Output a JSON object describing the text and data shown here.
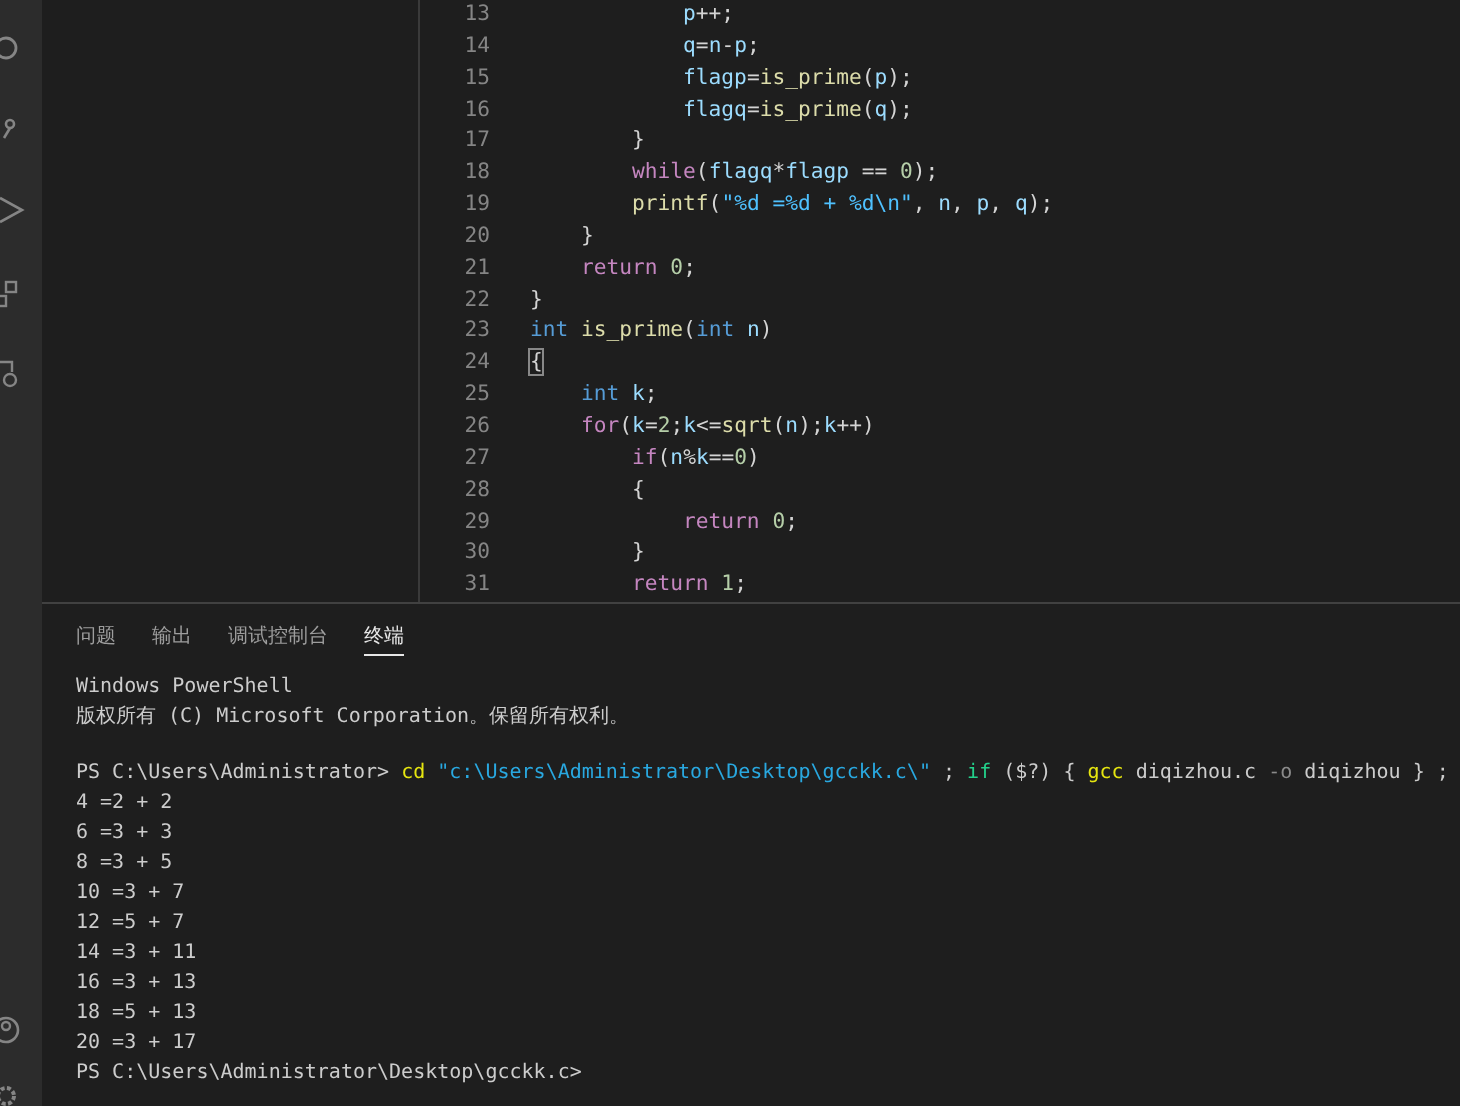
{
  "editor": {
    "lines": [
      {
        "number": "13",
        "tokens": [
          {
            "kind": "var",
            "text": "            p"
          },
          {
            "kind": "punct",
            "text": "++;"
          }
        ]
      },
      {
        "number": "14",
        "tokens": [
          {
            "kind": "var",
            "text": "            q"
          },
          {
            "kind": "punct",
            "text": "="
          },
          {
            "kind": "var",
            "text": "n"
          },
          {
            "kind": "punct",
            "text": "-"
          },
          {
            "kind": "var",
            "text": "p"
          },
          {
            "kind": "punct",
            "text": ";"
          }
        ]
      },
      {
        "number": "15",
        "tokens": [
          {
            "kind": "var",
            "text": "            flagp"
          },
          {
            "kind": "punct",
            "text": "="
          },
          {
            "kind": "fn",
            "text": "is_prime"
          },
          {
            "kind": "punct",
            "text": "("
          },
          {
            "kind": "var",
            "text": "p"
          },
          {
            "kind": "punct",
            "text": ");"
          }
        ]
      },
      {
        "number": "16",
        "tokens": [
          {
            "kind": "var",
            "text": "            flagq"
          },
          {
            "kind": "punct",
            "text": "="
          },
          {
            "kind": "fn",
            "text": "is_prime"
          },
          {
            "kind": "punct",
            "text": "("
          },
          {
            "kind": "var",
            "text": "q"
          },
          {
            "kind": "punct",
            "text": ");"
          }
        ]
      },
      {
        "number": "17",
        "tokens": [
          {
            "kind": "punct",
            "text": "        }"
          }
        ]
      },
      {
        "number": "18",
        "tokens": [
          {
            "kind": "kw",
            "text": "        while"
          },
          {
            "kind": "punct",
            "text": "("
          },
          {
            "kind": "var",
            "text": "flagq"
          },
          {
            "kind": "punct",
            "text": "*"
          },
          {
            "kind": "var",
            "text": "flagp"
          },
          {
            "kind": "punct",
            "text": " == "
          },
          {
            "kind": "num",
            "text": "0"
          },
          {
            "kind": "punct",
            "text": ");"
          }
        ]
      },
      {
        "number": "19",
        "tokens": [
          {
            "kind": "fn",
            "text": "        printf"
          },
          {
            "kind": "punct",
            "text": "("
          },
          {
            "kind": "str",
            "text": "\"%d =%d + %d\\n\""
          },
          {
            "kind": "punct",
            "text": ", "
          },
          {
            "kind": "var",
            "text": "n"
          },
          {
            "kind": "punct",
            "text": ", "
          },
          {
            "kind": "var",
            "text": "p"
          },
          {
            "kind": "punct",
            "text": ", "
          },
          {
            "kind": "var",
            "text": "q"
          },
          {
            "kind": "punct",
            "text": ");"
          }
        ]
      },
      {
        "number": "20",
        "tokens": [
          {
            "kind": "punct",
            "text": "    }"
          }
        ]
      },
      {
        "number": "21",
        "tokens": [
          {
            "kind": "kw",
            "text": "    return "
          },
          {
            "kind": "num",
            "text": "0"
          },
          {
            "kind": "punct",
            "text": ";"
          }
        ]
      },
      {
        "number": "22",
        "tokens": [
          {
            "kind": "punct",
            "text": "}"
          }
        ]
      },
      {
        "number": "23",
        "tokens": [
          {
            "kind": "type",
            "text": "int "
          },
          {
            "kind": "fn",
            "text": "is_prime"
          },
          {
            "kind": "punct",
            "text": "("
          },
          {
            "kind": "type",
            "text": "int"
          },
          {
            "kind": "var",
            "text": " n"
          },
          {
            "kind": "punct",
            "text": ")"
          }
        ]
      },
      {
        "number": "24",
        "tokens": [
          {
            "kind": "match",
            "text": "{"
          }
        ]
      },
      {
        "number": "25",
        "tokens": [
          {
            "kind": "type",
            "text": "    int"
          },
          {
            "kind": "var",
            "text": " k"
          },
          {
            "kind": "punct",
            "text": ";"
          }
        ]
      },
      {
        "number": "26",
        "tokens": [
          {
            "kind": "kw",
            "text": "    for"
          },
          {
            "kind": "punct",
            "text": "("
          },
          {
            "kind": "var",
            "text": "k"
          },
          {
            "kind": "punct",
            "text": "="
          },
          {
            "kind": "num",
            "text": "2"
          },
          {
            "kind": "punct",
            "text": ";"
          },
          {
            "kind": "var",
            "text": "k"
          },
          {
            "kind": "punct",
            "text": "<="
          },
          {
            "kind": "fn",
            "text": "sqrt"
          },
          {
            "kind": "punct",
            "text": "("
          },
          {
            "kind": "var",
            "text": "n"
          },
          {
            "kind": "punct",
            "text": ");"
          },
          {
            "kind": "var",
            "text": "k"
          },
          {
            "kind": "punct",
            "text": "++)"
          }
        ]
      },
      {
        "number": "27",
        "tokens": [
          {
            "kind": "kw",
            "text": "        if"
          },
          {
            "kind": "punct",
            "text": "("
          },
          {
            "kind": "var",
            "text": "n"
          },
          {
            "kind": "punct",
            "text": "%"
          },
          {
            "kind": "var",
            "text": "k"
          },
          {
            "kind": "punct",
            "text": "=="
          },
          {
            "kind": "num",
            "text": "0"
          },
          {
            "kind": "punct",
            "text": ")"
          }
        ]
      },
      {
        "number": "28",
        "tokens": [
          {
            "kind": "punct",
            "text": "        {"
          }
        ]
      },
      {
        "number": "29",
        "tokens": [
          {
            "kind": "kw",
            "text": "            return "
          },
          {
            "kind": "num",
            "text": "0"
          },
          {
            "kind": "punct",
            "text": ";"
          }
        ]
      },
      {
        "number": "30",
        "tokens": [
          {
            "kind": "punct",
            "text": "        }"
          }
        ]
      },
      {
        "number": "31",
        "tokens": [
          {
            "kind": "kw",
            "text": "        return "
          },
          {
            "kind": "num",
            "text": "1"
          },
          {
            "kind": "punct",
            "text": ";"
          }
        ]
      }
    ]
  },
  "panel": {
    "tabs": [
      {
        "label": "问题",
        "selected": false
      },
      {
        "label": "输出",
        "selected": false
      },
      {
        "label": "调试控制台",
        "selected": false
      },
      {
        "label": "终端",
        "selected": true
      }
    ],
    "terminal": {
      "blocks": [
        {
          "lines": [
            [
              {
                "kind": "plain",
                "text": "Windows PowerShell"
              }
            ],
            [
              {
                "kind": "plain",
                "text": "版权所有 (C) Microsoft Corporation。保留所有权利。"
              }
            ]
          ]
        },
        {
          "lines": [
            [
              {
                "kind": "plain",
                "text": "PS C:\\Users\\Administrator> "
              },
              {
                "kind": "cmd",
                "text": "cd"
              },
              {
                "kind": "str",
                "text": " \"c:\\Users\\Administrator\\Desktop\\gcckk.c\\\""
              },
              {
                "kind": "plain",
                "text": " ; "
              },
              {
                "kind": "kw",
                "text": "if"
              },
              {
                "kind": "plain",
                "text": " ($?) { "
              },
              {
                "kind": "cmd",
                "text": "gcc"
              },
              {
                "kind": "plain",
                "text": " diqizhou.c "
              },
              {
                "kind": "flag",
                "text": "-o"
              },
              {
                "kind": "plain",
                "text": " diqizhou } ;"
              }
            ],
            [
              {
                "kind": "plain",
                "text": "4 =2 + 2"
              }
            ],
            [
              {
                "kind": "plain",
                "text": "6 =3 + 3"
              }
            ],
            [
              {
                "kind": "plain",
                "text": "8 =3 + 5"
              }
            ],
            [
              {
                "kind": "plain",
                "text": "10 =3 + 7"
              }
            ],
            [
              {
                "kind": "plain",
                "text": "12 =5 + 7"
              }
            ],
            [
              {
                "kind": "plain",
                "text": "14 =3 + 11"
              }
            ],
            [
              {
                "kind": "plain",
                "text": "16 =3 + 13"
              }
            ],
            [
              {
                "kind": "plain",
                "text": "18 =5 + 13"
              }
            ],
            [
              {
                "kind": "plain",
                "text": "20 =3 + 17"
              }
            ],
            [
              {
                "kind": "plain",
                "text": "PS C:\\Users\\Administrator\\Desktop\\gcckk.c>"
              }
            ]
          ]
        }
      ]
    }
  }
}
